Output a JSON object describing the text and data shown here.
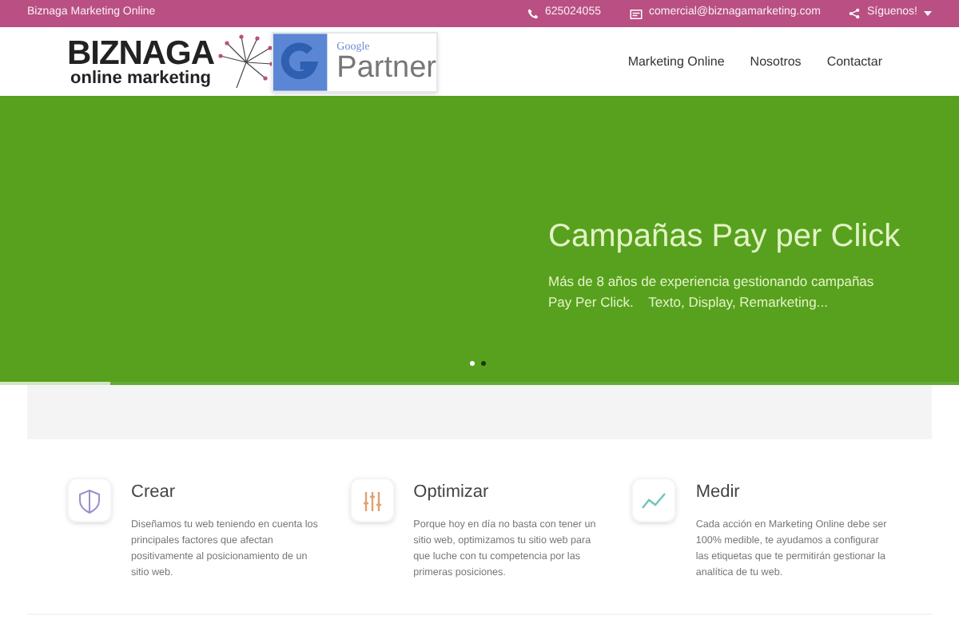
{
  "top_bar": {
    "site_name": "Biznaga Marketing Online",
    "phone": "625024055",
    "email": "comercial@biznagamarketing.com",
    "social": "Síguenos!"
  },
  "logo": {
    "name": "BIZNAGA",
    "tagline": "online marketing"
  },
  "badge": {
    "brand": "Google",
    "label": "Partner"
  },
  "nav": [
    {
      "label": "Marketing Online"
    },
    {
      "label": "Nosotros"
    },
    {
      "label": "Contactar"
    }
  ],
  "hero": {
    "title": "Campañas Pay per Click",
    "text": "Más de 8 años de experiencia gestionando campañas Pay Per Click.    Texto, Display, Remarketing...",
    "level": 0.115,
    "dots": [
      {
        "selected": false
      },
      {
        "selected": true
      }
    ]
  },
  "features": [
    {
      "kind": "shield",
      "title": "Crear",
      "text": "Diseñamos tu web teniendo en cuenta los principales factores que afectan positivamente al posicionamiento de un sitio web."
    },
    {
      "kind": "sliders",
      "title": "Optimizar",
      "text": "Porque hoy en día no basta con tener un sitio web, optimizamos tu sitio web para que luche con tu competencia por las primeras posiciones."
    },
    {
      "kind": "chart",
      "title": "Medir",
      "text": "Cada acción en Marketing Online debe ser 100% medible, te ayudamos a configurar las etiquetas que te permitirán gestionar la analítica de tu web."
    }
  ]
}
